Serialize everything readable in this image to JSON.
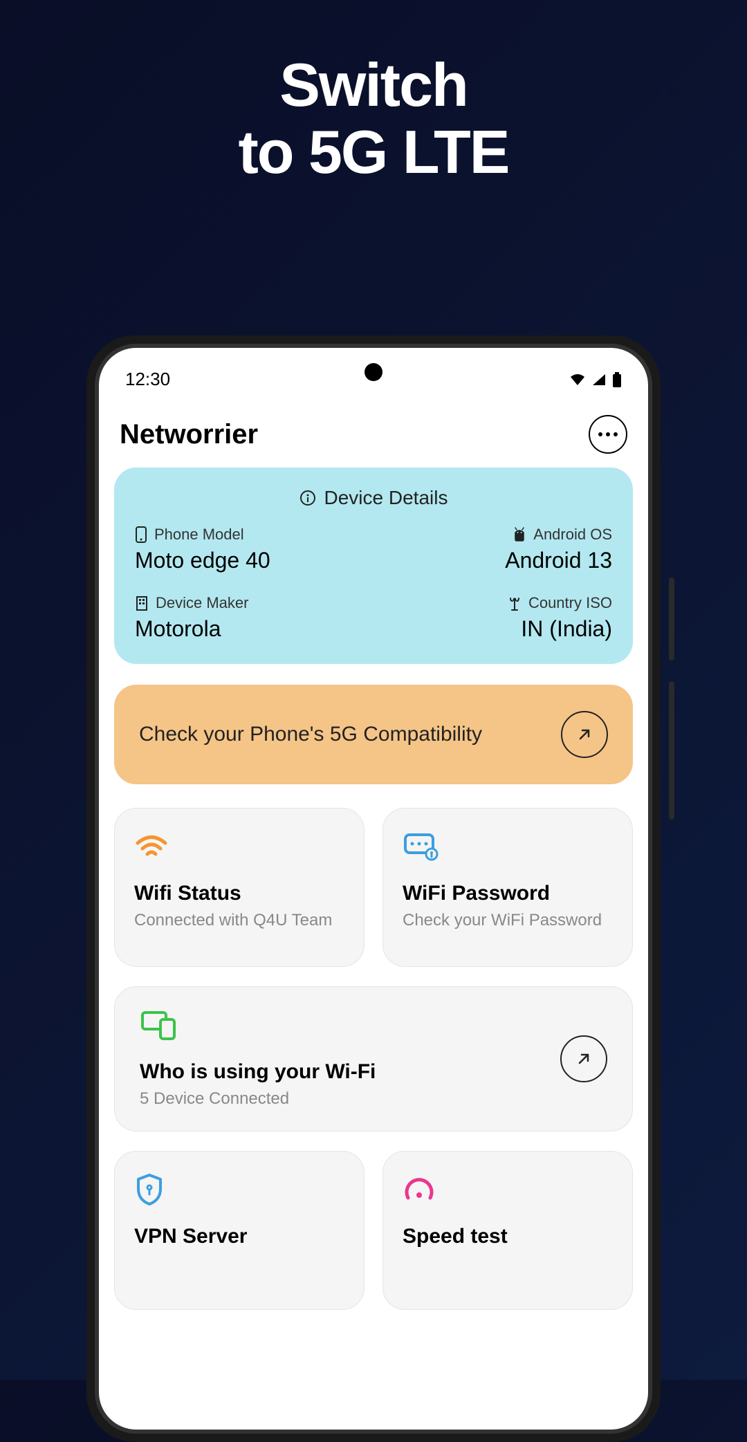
{
  "promo": {
    "line1": "Switch",
    "line2": "to 5G LTE"
  },
  "status": {
    "time": "12:30"
  },
  "header": {
    "title": "Networrier"
  },
  "device_card": {
    "header": "Device Details",
    "phone_model_label": "Phone Model",
    "phone_model_value": "Moto edge 40",
    "android_os_label": "Android OS",
    "android_os_value": "Android 13",
    "device_maker_label": "Device Maker",
    "device_maker_value": "Motorola",
    "country_iso_label": "Country ISO",
    "country_iso_value": "IN (India)"
  },
  "compat": {
    "text": "Check your Phone's 5G Compatibility"
  },
  "cards": {
    "wifi_status": {
      "title": "Wifi Status",
      "subtitle": "Connected with Q4U Team"
    },
    "wifi_password": {
      "title": "WiFi Password",
      "subtitle": "Check your WiFi Password"
    },
    "who_wifi": {
      "title": "Who is using your Wi-Fi",
      "subtitle": "5 Device Connected"
    },
    "vpn": {
      "title": "VPN Server"
    },
    "speed": {
      "title": "Speed test"
    }
  }
}
